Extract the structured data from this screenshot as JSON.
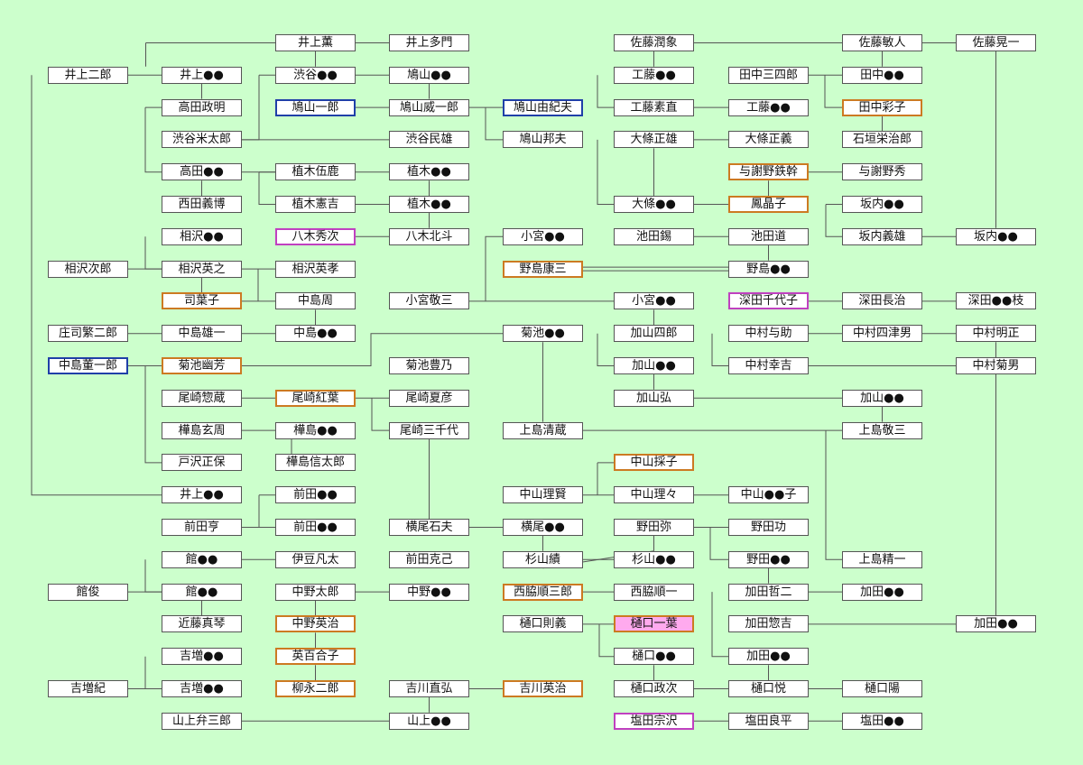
{
  "colors": {
    "background": "#ccffcc",
    "box_border": "#555555",
    "blue_border": "#1f3fa8",
    "orange_border": "#cc7a22",
    "magenta_border": "#c040c0",
    "pink_fill": "#ffaaee",
    "line": "#555555"
  },
  "nodes": [
    {
      "id": "a01",
      "col": 0,
      "row": 1,
      "label": "井上二郎"
    },
    {
      "id": "a02",
      "col": 0,
      "row": 7,
      "label": "相沢次郎"
    },
    {
      "id": "a03",
      "col": 0,
      "row": 9,
      "label": "庄司繁二郎"
    },
    {
      "id": "a04",
      "col": 0,
      "row": 10,
      "label": "中島董一郎",
      "style": "blue"
    },
    {
      "id": "a05",
      "col": 0,
      "row": 17,
      "label": "館俊"
    },
    {
      "id": "a06",
      "col": 0,
      "row": 20,
      "label": "吉増紀"
    },
    {
      "id": "b01",
      "col": 1,
      "row": 1,
      "label": "井上●●"
    },
    {
      "id": "b02",
      "col": 1,
      "row": 2,
      "label": "高田政明"
    },
    {
      "id": "b03",
      "col": 1,
      "row": 3,
      "label": "渋谷米太郎"
    },
    {
      "id": "b04",
      "col": 1,
      "row": 4,
      "label": "高田●●"
    },
    {
      "id": "b05",
      "col": 1,
      "row": 5,
      "label": "西田義博"
    },
    {
      "id": "b06",
      "col": 1,
      "row": 6,
      "label": "相沢●●"
    },
    {
      "id": "b07",
      "col": 1,
      "row": 7,
      "label": "相沢英之"
    },
    {
      "id": "b08",
      "col": 1,
      "row": 8,
      "label": "司葉子",
      "style": "orange"
    },
    {
      "id": "b09",
      "col": 1,
      "row": 9,
      "label": "中島雄一"
    },
    {
      "id": "b10",
      "col": 1,
      "row": 10,
      "label": "菊池幽芳",
      "style": "orange"
    },
    {
      "id": "b11",
      "col": 1,
      "row": 11,
      "label": "尾崎惣蔵"
    },
    {
      "id": "b12",
      "col": 1,
      "row": 12,
      "label": "樺島玄周"
    },
    {
      "id": "b13",
      "col": 1,
      "row": 13,
      "label": "戸沢正保"
    },
    {
      "id": "b14",
      "col": 1,
      "row": 14,
      "label": "井上●●"
    },
    {
      "id": "b15",
      "col": 1,
      "row": 15,
      "label": "前田亨"
    },
    {
      "id": "b16",
      "col": 1,
      "row": 16,
      "label": "館●●"
    },
    {
      "id": "b17",
      "col": 1,
      "row": 17,
      "label": "館●●"
    },
    {
      "id": "b18",
      "col": 1,
      "row": 18,
      "label": "近藤真琴"
    },
    {
      "id": "b19",
      "col": 1,
      "row": 19,
      "label": "吉増●●"
    },
    {
      "id": "b20",
      "col": 1,
      "row": 20,
      "label": "吉増●●"
    },
    {
      "id": "b21",
      "col": 1,
      "row": 21,
      "label": "山上弁三郎"
    },
    {
      "id": "c01",
      "col": 2,
      "row": 0,
      "label": "井上薫"
    },
    {
      "id": "c02",
      "col": 2,
      "row": 1,
      "label": "渋谷●●"
    },
    {
      "id": "c03",
      "col": 2,
      "row": 2,
      "label": "鳩山一郎",
      "style": "blue"
    },
    {
      "id": "c04",
      "col": 2,
      "row": 4,
      "label": "植木伍鹿"
    },
    {
      "id": "c05",
      "col": 2,
      "row": 5,
      "label": "植木憲吉"
    },
    {
      "id": "c06",
      "col": 2,
      "row": 6,
      "label": "八木秀次",
      "style": "magenta"
    },
    {
      "id": "c07",
      "col": 2,
      "row": 7,
      "label": "相沢英孝"
    },
    {
      "id": "c08",
      "col": 2,
      "row": 8,
      "label": "中島周"
    },
    {
      "id": "c09",
      "col": 2,
      "row": 9,
      "label": "中島●●"
    },
    {
      "id": "c10",
      "col": 2,
      "row": 11,
      "label": "尾崎紅葉",
      "style": "orange"
    },
    {
      "id": "c11",
      "col": 2,
      "row": 12,
      "label": "樺島●●"
    },
    {
      "id": "c12",
      "col": 2,
      "row": 13,
      "label": "樺島信太郎"
    },
    {
      "id": "c13",
      "col": 2,
      "row": 14,
      "label": "前田●●"
    },
    {
      "id": "c14",
      "col": 2,
      "row": 15,
      "label": "前田●●"
    },
    {
      "id": "c15",
      "col": 2,
      "row": 16,
      "label": "伊豆凡太"
    },
    {
      "id": "c16",
      "col": 2,
      "row": 17,
      "label": "中野太郎"
    },
    {
      "id": "c17",
      "col": 2,
      "row": 18,
      "label": "中野英治",
      "style": "orange"
    },
    {
      "id": "c18",
      "col": 2,
      "row": 19,
      "label": "英百合子",
      "style": "orange"
    },
    {
      "id": "c19",
      "col": 2,
      "row": 20,
      "label": "柳永二郎",
      "style": "orange"
    },
    {
      "id": "d01",
      "col": 3,
      "row": 0,
      "label": "井上多門"
    },
    {
      "id": "d02",
      "col": 3,
      "row": 1,
      "label": "鳩山●●"
    },
    {
      "id": "d03",
      "col": 3,
      "row": 2,
      "label": "鳩山威一郎"
    },
    {
      "id": "d04",
      "col": 3,
      "row": 3,
      "label": "渋谷民雄"
    },
    {
      "id": "d05",
      "col": 3,
      "row": 4,
      "label": "植木●●"
    },
    {
      "id": "d06",
      "col": 3,
      "row": 5,
      "label": "植木●●"
    },
    {
      "id": "d07",
      "col": 3,
      "row": 6,
      "label": "八木北斗"
    },
    {
      "id": "d08",
      "col": 3,
      "row": 8,
      "label": "小宮敬三"
    },
    {
      "id": "d09",
      "col": 3,
      "row": 10,
      "label": "菊池豊乃"
    },
    {
      "id": "d10",
      "col": 3,
      "row": 11,
      "label": "尾崎夏彦"
    },
    {
      "id": "d11",
      "col": 3,
      "row": 12,
      "label": "尾崎三千代"
    },
    {
      "id": "d12",
      "col": 3,
      "row": 15,
      "label": "横尾石夫"
    },
    {
      "id": "d13",
      "col": 3,
      "row": 16,
      "label": "前田克己"
    },
    {
      "id": "d14",
      "col": 3,
      "row": 17,
      "label": "中野●●"
    },
    {
      "id": "d15",
      "col": 3,
      "row": 20,
      "label": "吉川直弘"
    },
    {
      "id": "d16",
      "col": 3,
      "row": 21,
      "label": "山上●●"
    },
    {
      "id": "e01",
      "col": 4,
      "row": 2,
      "label": "鳩山由紀夫",
      "style": "blue"
    },
    {
      "id": "e02",
      "col": 4,
      "row": 3,
      "label": "鳩山邦夫"
    },
    {
      "id": "e03",
      "col": 4,
      "row": 6,
      "label": "小宮●●"
    },
    {
      "id": "e04",
      "col": 4,
      "row": 7,
      "label": "野島康三",
      "style": "orange"
    },
    {
      "id": "e05",
      "col": 4,
      "row": 9,
      "label": "菊池●●"
    },
    {
      "id": "e06",
      "col": 4,
      "row": 12,
      "label": "上島清蔵"
    },
    {
      "id": "e07",
      "col": 4,
      "row": 14,
      "label": "中山理賢"
    },
    {
      "id": "e08",
      "col": 4,
      "row": 15,
      "label": "横尾●●"
    },
    {
      "id": "e09",
      "col": 4,
      "row": 16,
      "label": "杉山績"
    },
    {
      "id": "e10",
      "col": 4,
      "row": 17,
      "label": "西脇順三郎",
      "style": "orange"
    },
    {
      "id": "e11",
      "col": 4,
      "row": 18,
      "label": "樋口則義"
    },
    {
      "id": "e12",
      "col": 4,
      "row": 20,
      "label": "吉川英治",
      "style": "orange"
    },
    {
      "id": "f01",
      "col": 5,
      "row": 0,
      "label": "佐藤潤象"
    },
    {
      "id": "f02",
      "col": 5,
      "row": 1,
      "label": "工藤●●"
    },
    {
      "id": "f03",
      "col": 5,
      "row": 2,
      "label": "工藤素直"
    },
    {
      "id": "f04",
      "col": 5,
      "row": 3,
      "label": "大條正雄"
    },
    {
      "id": "f05",
      "col": 5,
      "row": 5,
      "label": "大條●●"
    },
    {
      "id": "f06",
      "col": 5,
      "row": 6,
      "label": "池田錫"
    },
    {
      "id": "f07",
      "col": 5,
      "row": 8,
      "label": "小宮●●"
    },
    {
      "id": "f08",
      "col": 5,
      "row": 9,
      "label": "加山四郎"
    },
    {
      "id": "f09",
      "col": 5,
      "row": 10,
      "label": "加山●●"
    },
    {
      "id": "f10",
      "col": 5,
      "row": 11,
      "label": "加山弘"
    },
    {
      "id": "f11",
      "col": 5,
      "row": 13,
      "label": "中山採子",
      "style": "orange"
    },
    {
      "id": "f12",
      "col": 5,
      "row": 14,
      "label": "中山理々"
    },
    {
      "id": "f13",
      "col": 5,
      "row": 15,
      "label": "野田弥"
    },
    {
      "id": "f14",
      "col": 5,
      "row": 16,
      "label": "杉山●●"
    },
    {
      "id": "f15",
      "col": 5,
      "row": 17,
      "label": "西脇順一"
    },
    {
      "id": "f16",
      "col": 5,
      "row": 18,
      "label": "樋口一葉",
      "style": "pinkfill"
    },
    {
      "id": "f17",
      "col": 5,
      "row": 19,
      "label": "樋口●●"
    },
    {
      "id": "f18",
      "col": 5,
      "row": 20,
      "label": "樋口政次"
    },
    {
      "id": "f19",
      "col": 5,
      "row": 21,
      "label": "塩田宗沢",
      "style": "magenta"
    },
    {
      "id": "g01",
      "col": 6,
      "row": 1,
      "label": "田中三四郎"
    },
    {
      "id": "g02",
      "col": 6,
      "row": 2,
      "label": "工藤●●"
    },
    {
      "id": "g03",
      "col": 6,
      "row": 3,
      "label": "大條正義"
    },
    {
      "id": "g04",
      "col": 6,
      "row": 4,
      "label": "与謝野鉄幹",
      "style": "orange"
    },
    {
      "id": "g05",
      "col": 6,
      "row": 5,
      "label": "鳳晶子",
      "style": "orange"
    },
    {
      "id": "g06",
      "col": 6,
      "row": 6,
      "label": "池田道"
    },
    {
      "id": "g07",
      "col": 6,
      "row": 7,
      "label": "野島●●"
    },
    {
      "id": "g08",
      "col": 6,
      "row": 8,
      "label": "深田千代子",
      "style": "magenta"
    },
    {
      "id": "g09",
      "col": 6,
      "row": 9,
      "label": "中村与助"
    },
    {
      "id": "g10",
      "col": 6,
      "row": 10,
      "label": "中村幸吉"
    },
    {
      "id": "g11",
      "col": 6,
      "row": 14,
      "label": "中山●●子"
    },
    {
      "id": "g12",
      "col": 6,
      "row": 15,
      "label": "野田功"
    },
    {
      "id": "g13",
      "col": 6,
      "row": 16,
      "label": "野田●●"
    },
    {
      "id": "g14",
      "col": 6,
      "row": 17,
      "label": "加田哲二"
    },
    {
      "id": "g15",
      "col": 6,
      "row": 18,
      "label": "加田惣吉"
    },
    {
      "id": "g16",
      "col": 6,
      "row": 19,
      "label": "加田●●"
    },
    {
      "id": "g17",
      "col": 6,
      "row": 20,
      "label": "樋口悦"
    },
    {
      "id": "g18",
      "col": 6,
      "row": 21,
      "label": "塩田良平"
    },
    {
      "id": "h01",
      "col": 7,
      "row": 0,
      "label": "佐藤敏人"
    },
    {
      "id": "h02",
      "col": 7,
      "row": 1,
      "label": "田中●●"
    },
    {
      "id": "h03",
      "col": 7,
      "row": 2,
      "label": "田中彩子",
      "style": "orange"
    },
    {
      "id": "h04",
      "col": 7,
      "row": 3,
      "label": "石垣栄治郎"
    },
    {
      "id": "h05",
      "col": 7,
      "row": 4,
      "label": "与謝野秀"
    },
    {
      "id": "h06",
      "col": 7,
      "row": 5,
      "label": "坂内●●"
    },
    {
      "id": "h07",
      "col": 7,
      "row": 6,
      "label": "坂内義雄"
    },
    {
      "id": "h08",
      "col": 7,
      "row": 8,
      "label": "深田長治"
    },
    {
      "id": "h09",
      "col": 7,
      "row": 9,
      "label": "中村四津男"
    },
    {
      "id": "h10",
      "col": 7,
      "row": 11,
      "label": "加山●●"
    },
    {
      "id": "h11",
      "col": 7,
      "row": 12,
      "label": "上島敬三"
    },
    {
      "id": "h12",
      "col": 7,
      "row": 16,
      "label": "上島精一"
    },
    {
      "id": "h13",
      "col": 7,
      "row": 17,
      "label": "加田●●"
    },
    {
      "id": "h14",
      "col": 7,
      "row": 20,
      "label": "樋口陽"
    },
    {
      "id": "h15",
      "col": 7,
      "row": 21,
      "label": "塩田●●"
    },
    {
      "id": "i01",
      "col": 8,
      "row": 0,
      "label": "佐藤晃一"
    },
    {
      "id": "i02",
      "col": 8,
      "row": 6,
      "label": "坂内●●"
    },
    {
      "id": "i03",
      "col": 8,
      "row": 8,
      "label": "深田●●枝"
    },
    {
      "id": "i04",
      "col": 8,
      "row": 9,
      "label": "中村明正"
    },
    {
      "id": "i05",
      "col": 8,
      "row": 10,
      "label": "中村菊男"
    },
    {
      "id": "i06",
      "col": 8,
      "row": 18,
      "label": "加田●●"
    }
  ]
}
